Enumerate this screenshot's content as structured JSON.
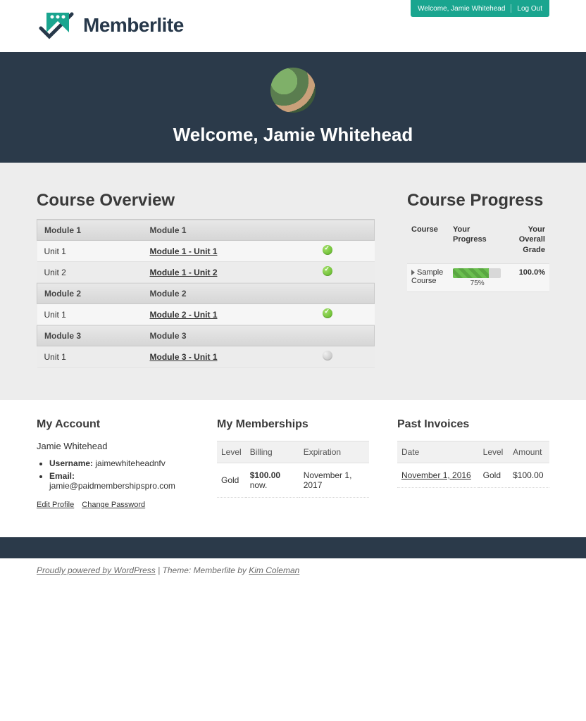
{
  "brand": {
    "name": "Memberlite"
  },
  "userbar": {
    "welcome": "Welcome, Jamie Whitehead",
    "logout": "Log Out"
  },
  "masthead": {
    "heading": "Welcome, Jamie Whitehead"
  },
  "overview": {
    "title": "Course Overview",
    "modules": [
      {
        "left": "Module 1",
        "right": "Module 1",
        "units": [
          {
            "left": "Unit 1",
            "link": "Module 1 - Unit 1",
            "status": "done"
          },
          {
            "left": "Unit 2",
            "link": "Module 1 - Unit 2",
            "status": "done"
          }
        ]
      },
      {
        "left": "Module 2",
        "right": "Module 2",
        "units": [
          {
            "left": "Unit 1",
            "link": "Module 2 - Unit 1",
            "status": "done"
          }
        ]
      },
      {
        "left": "Module 3",
        "right": "Module 3",
        "units": [
          {
            "left": "Unit 1",
            "link": "Module 3 - Unit 1",
            "status": "pending"
          }
        ]
      }
    ]
  },
  "progress": {
    "title": "Course Progress",
    "headers": {
      "course": "Course",
      "your": "Your Progress",
      "grade": "Your Overall Grade"
    },
    "rows": [
      {
        "course": "Sample Course",
        "percent": 75,
        "percent_label": "75%",
        "grade": "100.0%"
      }
    ]
  },
  "account": {
    "title": "My Account",
    "name": "Jamie Whitehead",
    "username_label": "Username:",
    "username": "jaimewhiteheadnfv",
    "email_label": "Email:",
    "email": "jamie@paidmembershipspro.com",
    "edit": "Edit Profile",
    "change_pw": "Change Password"
  },
  "memberships": {
    "title": "My Memberships",
    "headers": {
      "level": "Level",
      "billing": "Billing",
      "exp": "Expiration"
    },
    "rows": [
      {
        "level": "Gold",
        "billing_amount": "$100.00",
        "billing_suffix": " now.",
        "exp": "November 1, 2017"
      }
    ]
  },
  "invoices": {
    "title": "Past Invoices",
    "headers": {
      "date": "Date",
      "level": "Level",
      "amount": "Amount"
    },
    "rows": [
      {
        "date": "November 1, 2016",
        "level": "Gold",
        "amount": "$100.00"
      }
    ]
  },
  "footer": {
    "wp": "Proudly powered by WordPress",
    "sep": " | ",
    "theme": "Theme: Memberlite by ",
    "author": "Kim Coleman"
  }
}
